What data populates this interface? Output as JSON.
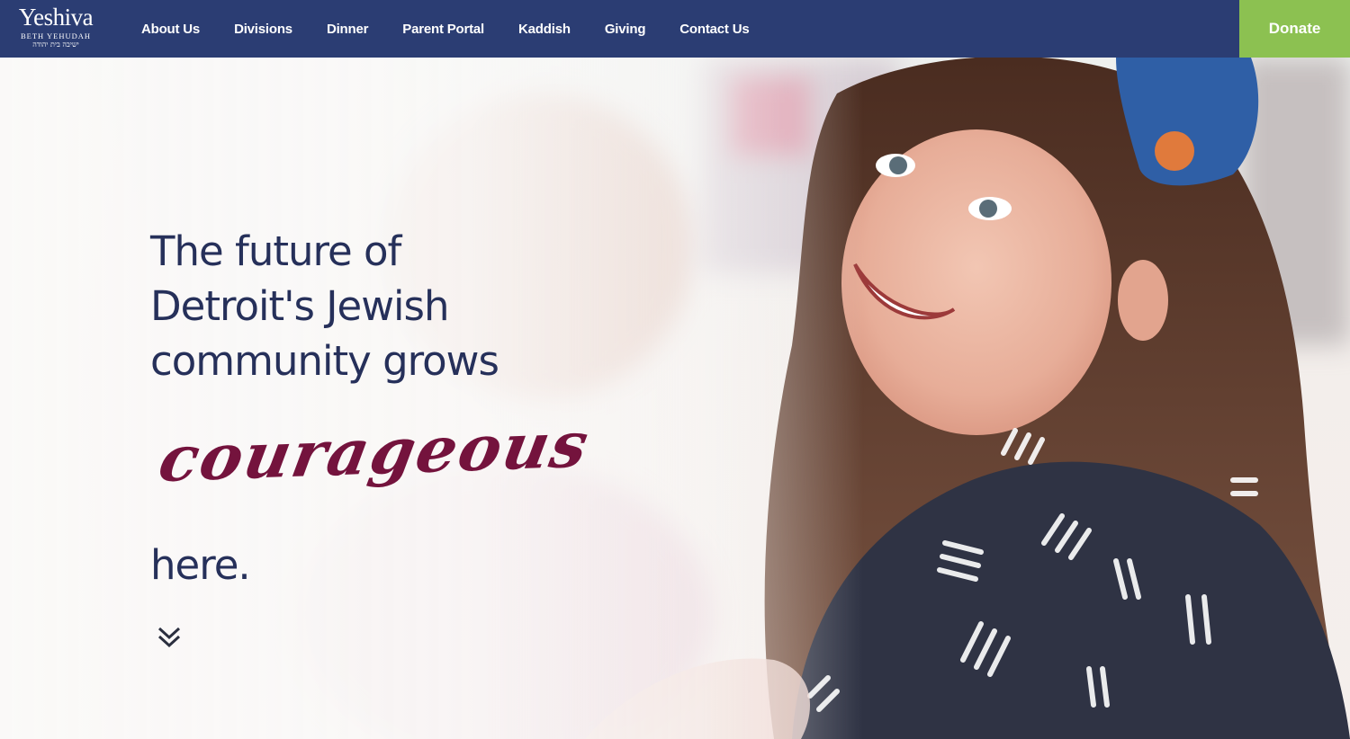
{
  "logo": {
    "wordmark": "Yeshiva",
    "subtitle": "BETH YEHUDAH",
    "hebrew": "ישיבה בית יהודה"
  },
  "nav": {
    "items": [
      {
        "label": "About Us"
      },
      {
        "label": "Divisions"
      },
      {
        "label": "Dinner"
      },
      {
        "label": "Parent Portal"
      },
      {
        "label": "Kaddish"
      },
      {
        "label": "Giving"
      },
      {
        "label": "Contact Us"
      }
    ],
    "donate_label": "Donate"
  },
  "hero": {
    "heading_lines": [
      "The future of",
      "Detroit's Jewish",
      "community grows"
    ],
    "script_word": "courageous",
    "closing_word": "here.",
    "scroll_icon": "double-chevron-down-icon"
  },
  "colors": {
    "nav_background": "#2b3d73",
    "donate_background": "#8cc151",
    "heading_text": "#26305a",
    "script_text": "#74133d"
  }
}
